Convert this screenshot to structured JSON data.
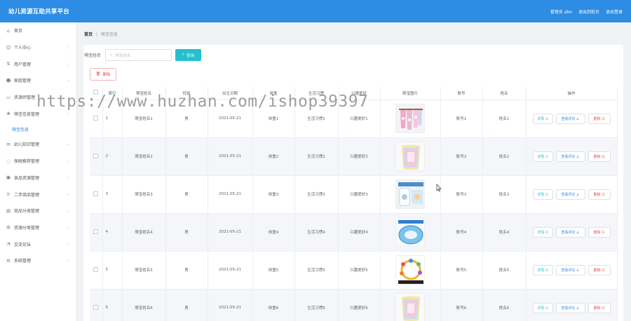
{
  "header": {
    "title": "幼儿资源互助共享平台",
    "user": "管理员 abo",
    "backend": "退出到前台",
    "logout": "退出登录"
  },
  "sidebar": {
    "items": [
      {
        "label": "首页",
        "icon": "home-icon",
        "glyph": "⌂",
        "chevron": false
      },
      {
        "label": "个人中心",
        "icon": "user-icon",
        "glyph": "☺",
        "chevron": true
      },
      {
        "label": "用户管理",
        "icon": "users-icon",
        "glyph": "⇅",
        "chevron": true
      },
      {
        "label": "家庭管理",
        "icon": "family-icon",
        "glyph": "☻",
        "chevron": true
      },
      {
        "label": "资源师管理",
        "icon": "teacher-icon",
        "glyph": "▭",
        "chevron": true
      },
      {
        "label": "萌宝信息管理",
        "icon": "baby-icon",
        "glyph": "❀",
        "chevron": true
      },
      {
        "label": "幼儿知识管理",
        "icon": "knowledge-icon",
        "glyph": "✉",
        "chevron": true
      },
      {
        "label": "保姆推荐管理",
        "icon": "nanny-icon",
        "glyph": "◌",
        "chevron": true
      },
      {
        "label": "食品资源管理",
        "icon": "food-icon",
        "glyph": "▣",
        "chevron": true
      },
      {
        "label": "二手商品管理",
        "icon": "goods-icon",
        "glyph": "≡",
        "chevron": true
      },
      {
        "label": "商品分类管理",
        "icon": "category-icon",
        "glyph": "▤",
        "chevron": true
      },
      {
        "label": "资源分类管理",
        "icon": "resource-icon",
        "glyph": "◍",
        "chevron": true
      },
      {
        "label": "交流论坛",
        "icon": "forum-icon",
        "glyph": "◔",
        "chevron": true
      },
      {
        "label": "系统管理",
        "icon": "settings-icon",
        "glyph": "⚙",
        "chevron": true
      }
    ],
    "sub_item": "萌宝信息"
  },
  "breadcrumb": {
    "home": "首页",
    "sep": "/",
    "current": "萌宝信息"
  },
  "search": {
    "label": "萌宝姓名",
    "placeholder": "萌宝姓名",
    "button": "查询"
  },
  "toolbar": {
    "delete": "删除"
  },
  "table": {
    "columns": [
      "索引",
      "萌宝姓名",
      "性别",
      "出生日期",
      "体重",
      "生活习惯",
      "兴趣爱好",
      "萌宝图片",
      "账号",
      "姓名",
      "操作"
    ],
    "rows": [
      {
        "index": "1",
        "name": "萌宝姓名1",
        "gender": "男",
        "birth": "2021-05-21",
        "weight": "体重1",
        "habit": "生活习惯1",
        "hobby": "兴趣爱好1",
        "image": "towel-hanging",
        "account": "账号1",
        "realname": "姓名1"
      },
      {
        "index": "2",
        "name": "萌宝姓名2",
        "gender": "男",
        "birth": "2021-05-21",
        "weight": "体重2",
        "habit": "生活习惯2",
        "hobby": "兴趣爱好2",
        "image": "towel-pastel",
        "account": "账号2",
        "realname": "姓名2"
      },
      {
        "index": "3",
        "name": "萌宝姓名3",
        "gender": "男",
        "birth": "2021-05-21",
        "weight": "体重3",
        "habit": "生活习惯3",
        "hobby": "兴趣爱好3",
        "image": "baby-product",
        "account": "账号3",
        "realname": "姓名3"
      },
      {
        "index": "4",
        "name": "萌宝姓名4",
        "gender": "男",
        "birth": "2021-05-21",
        "weight": "体重4",
        "habit": "生活习惯4",
        "hobby": "兴趣爱好4",
        "image": "shower-cap",
        "account": "账号4",
        "realname": "姓名4"
      },
      {
        "index": "5",
        "name": "萌宝姓名5",
        "gender": "男",
        "birth": "2021-05-21",
        "weight": "体重5",
        "habit": "生活习惯5",
        "hobby": "兴趣爱好5",
        "image": "teether-ring",
        "account": "账号5",
        "realname": "姓名5"
      },
      {
        "index": "6",
        "name": "萌宝姓名6",
        "gender": "男",
        "birth": "2021-05-21",
        "weight": "体重6",
        "habit": "生活习惯6",
        "hobby": "兴趣爱好6",
        "image": "towel-pastel",
        "account": "账号6",
        "realname": "姓名6"
      }
    ],
    "actions": {
      "detail": "详情 ⊙",
      "review": "查看评论 ∠",
      "delete": "删除 ⊡"
    }
  },
  "watermark": "https://www.huzhan.com/ishop39397",
  "colors": {
    "header": "#2d8ce3",
    "search_button": "#24c0cf",
    "danger": "#e65050",
    "active_sub": "#2d8ce3"
  }
}
